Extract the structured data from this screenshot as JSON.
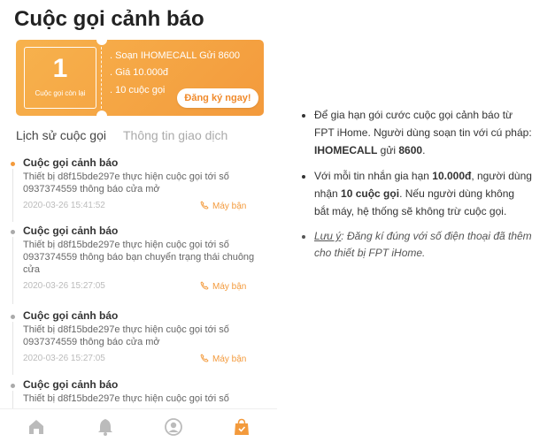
{
  "screen": {
    "title": "Cuộc gọi cảnh báo",
    "ticket": {
      "count": "1",
      "count_label": "Cuộc gọi còn lại",
      "lines": [
        ". Soạn IHOMECALL Gửi 8600",
        ". Giá 10.000đ",
        ". 10 cuộc gọi"
      ],
      "register_label": "Đăng ký ngay!"
    },
    "tabs": [
      "Lịch sử cuộc gọi",
      "Thông tin giao dịch"
    ],
    "history": [
      {
        "title": "Cuộc gọi cảnh báo",
        "desc": "Thiết bị d8f15bde297e thực hiện cuộc gọi tới số 0937374559 thông báo cửa mở",
        "time": "2020-03-26 15:41:52",
        "status": "Máy bận"
      },
      {
        "title": "Cuộc gọi cảnh báo",
        "desc": "Thiết bị d8f15bde297e thực hiện cuộc gọi tới số 0937374559 thông báo bạn chuyển trạng thái chuông cửa",
        "time": "2020-03-26 15:27:05",
        "status": "Máy bận"
      },
      {
        "title": "Cuộc gọi cảnh báo",
        "desc": "Thiết bị d8f15bde297e thực hiện cuộc gọi tới số 0937374559 thông báo cửa mở",
        "time": "2020-03-26 15:27:05",
        "status": "Máy bận"
      },
      {
        "title": "Cuộc gọi cảnh báo",
        "desc": "Thiết bị d8f15bde297e thực hiện cuộc gọi tới số",
        "time": "",
        "status": ""
      }
    ],
    "nav_icons": [
      "home-icon",
      "bell-icon",
      "profile-icon",
      "shopping-bag-icon"
    ]
  },
  "info": {
    "bullet1": {
      "text_a": "Để gia hạn gói cước cuộc gọi cảnh báo từ FPT iHome. Người dùng soạn tin với cú pháp: ",
      "bold": "IHOMECALL",
      "text_b": " gửi ",
      "bold2": "8600",
      "text_c": "."
    },
    "bullet2": {
      "text_a": "Với mỗi tin nhắn gia hạn ",
      "bold": "10.000đ",
      "text_b": ", người dùng nhận ",
      "bold2": "10 cuộc gọi",
      "text_c": ". Nếu người dùng không bắt máy, hệ thống sẽ không trừ cuộc gọi."
    },
    "note": {
      "label": "Lưu ý",
      "text": ": Đăng kí đúng với số điện thoại đã thêm cho thiết bị FPT iHome."
    }
  },
  "colors": {
    "accent": "#f39a3c",
    "dot_active": "#f39a3c",
    "dot_inactive": "#aaaaaa"
  }
}
